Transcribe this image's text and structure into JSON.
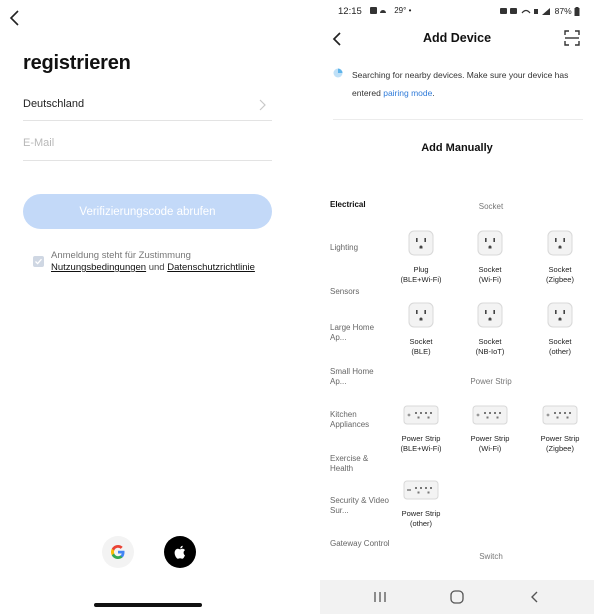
{
  "left": {
    "title": "registrieren",
    "country": "Deutschland",
    "email_placeholder": "E-Mail",
    "verify_button": "Verifizierungscode abrufen",
    "consent_line1": "Anmeldung steht für Zustimmung",
    "terms_link": "Nutzungsbedingungen",
    "and_word": "und",
    "privacy_link": "Datenschutzrichtlinie"
  },
  "right": {
    "status": {
      "time": "12:15",
      "weather": "29°",
      "battery": "87%"
    },
    "header_title": "Add Device",
    "notice_text": "Searching for nearby devices. Make sure your device has entered",
    "notice_link": "pairing mode",
    "notice_end": ".",
    "add_manually": "Add Manually",
    "categories": [
      "Electrical",
      "Lighting",
      "Sensors",
      "Large Home Ap...",
      "Small Home Ap...",
      "Kitchen Appliances",
      "Exercise & Health",
      "Security & Video Sur...",
      "Gateway Control"
    ],
    "sections": {
      "socket": "Socket",
      "power_strip": "Power Strip",
      "switch": "Switch"
    },
    "socket_devices": [
      {
        "name": "Plug",
        "sub": "(BLE+Wi-Fi)"
      },
      {
        "name": "Socket",
        "sub": "(Wi-Fi)"
      },
      {
        "name": "Socket",
        "sub": "(Zigbee)"
      },
      {
        "name": "Socket",
        "sub": "(BLE)"
      },
      {
        "name": "Socket",
        "sub": "(NB-IoT)"
      },
      {
        "name": "Socket",
        "sub": "(other)"
      }
    ],
    "strip_devices": [
      {
        "name": "Power Strip",
        "sub": "(BLE+Wi-Fi)"
      },
      {
        "name": "Power Strip",
        "sub": "(Wi-Fi)"
      },
      {
        "name": "Power Strip",
        "sub": "(Zigbee)"
      },
      {
        "name": "Power Strip",
        "sub": "(other)"
      }
    ]
  }
}
